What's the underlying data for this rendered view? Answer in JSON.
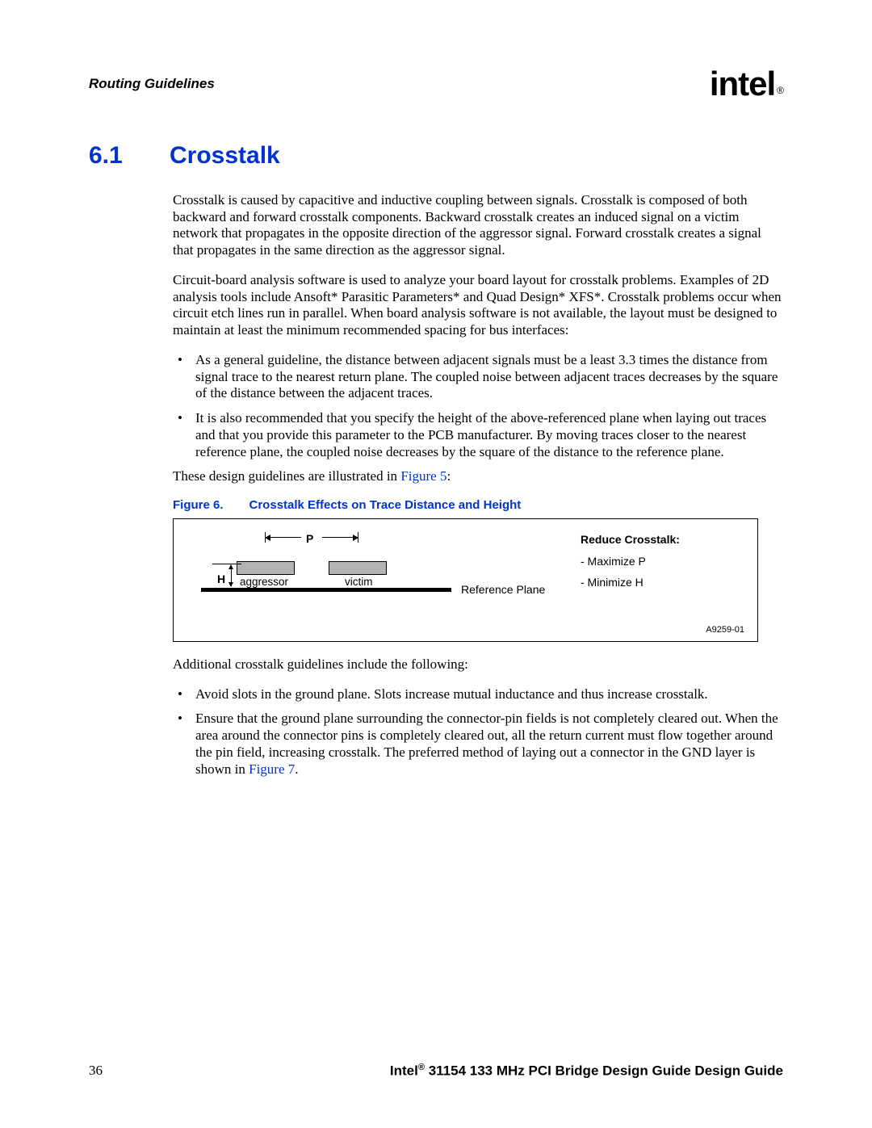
{
  "header": {
    "title": "Routing Guidelines",
    "logo_text": "intel",
    "logo_reg": "®"
  },
  "section": {
    "number": "6.1",
    "title": "Crosstalk"
  },
  "paragraphs": {
    "p1": "Crosstalk is caused by capacitive and inductive coupling between signals. Crosstalk is composed of both backward and forward crosstalk components. Backward crosstalk creates an induced signal on a victim network that propagates in the opposite direction of the aggressor signal. Forward crosstalk creates a signal that propagates in the same direction as the aggressor signal.",
    "p2": "Circuit-board analysis software is used to analyze your board layout for crosstalk problems. Examples of 2D analysis tools include Ansoft* Parasitic Parameters* and Quad Design* XFS*. Crosstalk problems occur when circuit etch lines run in parallel. When board analysis software is not available, the layout must be designed to maintain at least the minimum recommended spacing for bus interfaces:",
    "b1": "As a general guideline, the distance between adjacent signals must be a least 3.3 times the distance from signal trace to the nearest return plane. The coupled noise between adjacent traces decreases by the square of the distance between the adjacent traces.",
    "b2": "It is also recommended that you specify the height of the above-referenced plane when laying out traces and that you provide this parameter to the PCB manufacturer. By moving traces closer to the nearest reference plane, the coupled noise decreases by the square of the distance to the reference plane.",
    "p3_pre": "These design guidelines are illustrated in ",
    "p3_link": "Figure 5",
    "p3_post": ":",
    "p4": "Additional crosstalk guidelines include the following:",
    "b3": "Avoid slots in the ground plane. Slots increase mutual inductance and thus increase crosstalk.",
    "b4_pre": "Ensure that the ground plane surrounding the connector-pin fields is not completely cleared out. When the area around the connector pins is completely cleared out, all the return current must flow together around the pin field, increasing crosstalk. The preferred method of laying out a connector in the GND layer is shown in ",
    "b4_link": "Figure 7",
    "b4_post": "."
  },
  "figure": {
    "label": "Figure 6.",
    "caption": "Crosstalk Effects on Trace Distance and Height",
    "p_label": "P",
    "h_label": "H",
    "aggressor": "aggressor",
    "victim": "victim",
    "ref_plane": "Reference Plane",
    "reduce_title": "Reduce Crosstalk:",
    "reduce_1": "- Maximize P",
    "reduce_2": "- Minimize H",
    "fig_id": "A9259-01"
  },
  "footer": {
    "page": "36",
    "doc_pre": "Intel",
    "doc_reg": "®",
    "doc_post": " 31154 133 MHz PCI Bridge Design Guide Design Guide"
  }
}
